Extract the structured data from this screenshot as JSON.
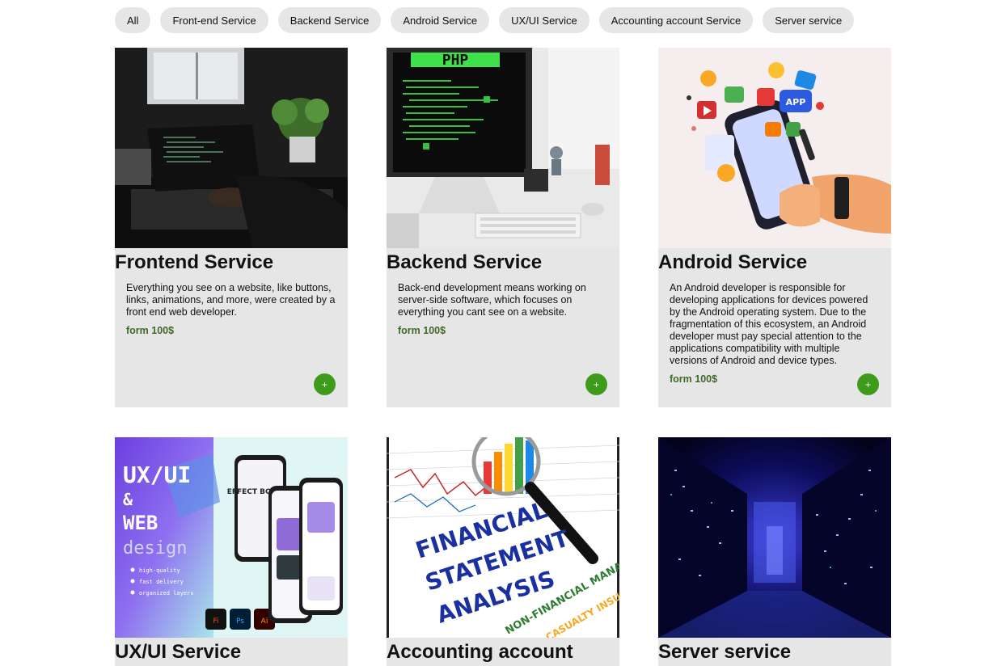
{
  "filters": [
    "All",
    "Front-end Service",
    "Backend Service",
    "Android Service",
    "UX/UI Service",
    "Accounting account Service",
    "Server service"
  ],
  "cards": [
    {
      "title": "Frontend Service",
      "description": "Everything you see on a website, like buttons, links, animations, and more, were created by a front end web developer.",
      "price": "form 100$",
      "add": "+"
    },
    {
      "title": "Backend Service",
      "description": "Back-end development means working on server-side software, which focuses on everything you cant see on a website.",
      "price": "form 100$",
      "add": "+",
      "image_text": "PHP"
    },
    {
      "title": "Android Service",
      "description": "An Android developer is responsible for developing applications for devices powered by the Android operating system. Due to the fragmentation of this ecosystem, an Android developer must pay special attention to the applications compatibility with multiple versions of Android and device types.",
      "price": "form 100$",
      "add": "+",
      "image_text": "APP"
    },
    {
      "title": "UX/UI Service",
      "image_text": {
        "line1": "UX/UI",
        "line2": "&",
        "line3": "WEB",
        "line4": "design",
        "bullets": [
          "high-quality",
          "fast delivery",
          "organized layers"
        ],
        "phone_text": "EFFECT BOUNCE",
        "tools": [
          "Fi",
          "Ps",
          "Ai"
        ]
      }
    },
    {
      "title": "Accounting account",
      "image_text": {
        "line1": "FINANCIAL",
        "line2": "STATEMENT",
        "line3": "ANALYSIS",
        "line4": "NON-FINANCIAL MANAGERS",
        "line5": "CASUALTY INSURANCE"
      }
    },
    {
      "title": "Server service"
    }
  ],
  "colors": {
    "accent": "#3f9b1a",
    "price": "#3d6a2a",
    "card_bg": "#e6e6e6",
    "chip_bg": "#e6e6e6"
  }
}
